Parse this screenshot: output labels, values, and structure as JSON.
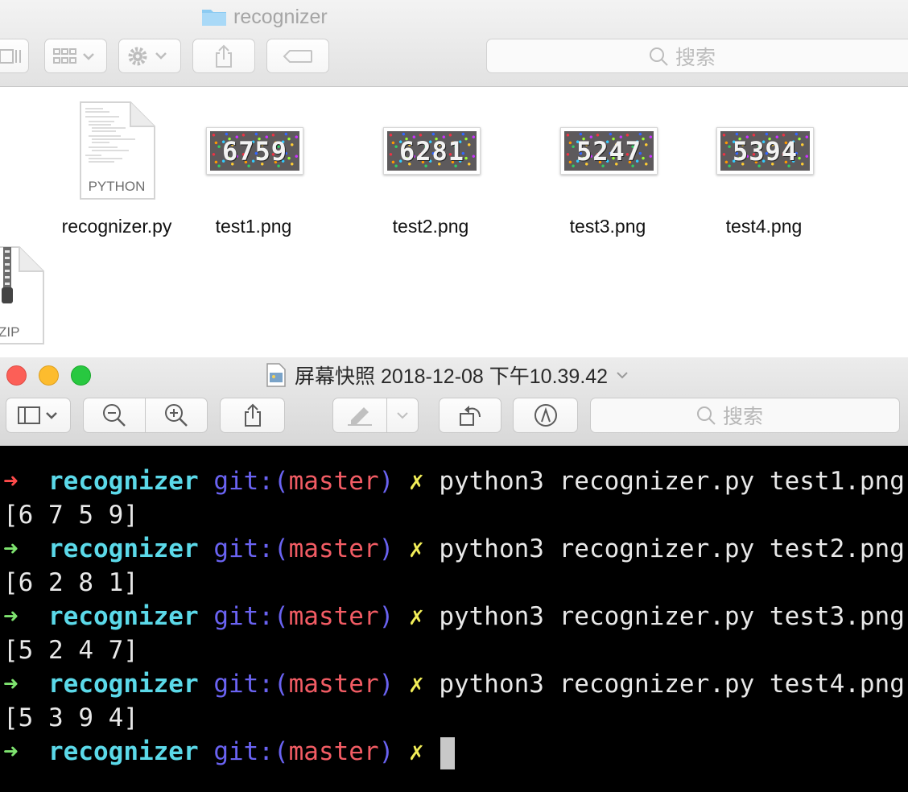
{
  "finder": {
    "folder_name": "recognizer",
    "search_placeholder": "搜索",
    "items": [
      {
        "name": "recognizer.py",
        "badge": "PYTHON"
      },
      {
        "name": "test1.png",
        "thumb_text": "6759"
      },
      {
        "name": "test2.png",
        "thumb_text": "6281"
      },
      {
        "name": "test3.png",
        "thumb_text": "5247"
      },
      {
        "name": "test4.png",
        "thumb_text": "5394"
      }
    ],
    "partial_item_badge": "ZIP"
  },
  "preview": {
    "title": "屏幕快照 2018-12-08 下午10.39.42",
    "search_placeholder": "搜索",
    "traffic_colors": {
      "close": "#fc5f57",
      "minimize": "#fdbc2e",
      "zoom": "#28c840"
    }
  },
  "terminal": {
    "prompt_arrow": "➜",
    "prompt_dir": "recognizer",
    "git_label": "git:(",
    "branch": "master",
    "git_close": ")",
    "dirty_mark": "✗",
    "lines": [
      {
        "command": "python3 recognizer.py test1.png",
        "output": "[6 7 5 9]"
      },
      {
        "command": "python3 recognizer.py test2.png",
        "output": "[6 2 8 1]"
      },
      {
        "command": "python3 recognizer.py test3.png",
        "output": "[5 2 4 7]"
      },
      {
        "command": "python3 recognizer.py test4.png",
        "output": "[5 3 9 4]"
      }
    ],
    "colors": {
      "failed_arrow": "#ff4b4b",
      "ok_arrow": "#7ee36f",
      "dir": "#5bd9e9",
      "git": "#6a63f2",
      "branch": "#f25c64",
      "dirty": "#f2ee58"
    }
  }
}
